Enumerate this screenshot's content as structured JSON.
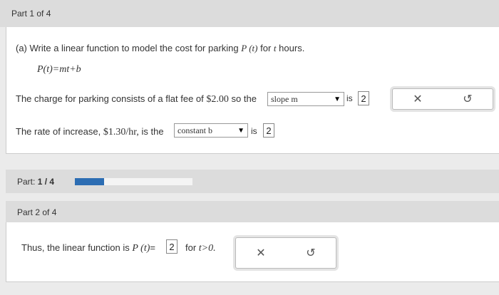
{
  "part1": {
    "header": "Part 1 of 4",
    "question": "(a) Write a linear function to model the cost for parking",
    "question_fn": "P (t)",
    "question_tail": "for",
    "question_var": "t",
    "question_end": "hours.",
    "formula": "P(t)=mt+b",
    "line1_text": "The charge for parking consists of a flat fee of",
    "line1_amount": "$2.00",
    "line1_so": "so the",
    "line1_select": "slope m",
    "line1_is": "is",
    "line1_value": "2",
    "line2_text": "The rate of increase,",
    "line2_amount": "$1.30/hr,",
    "line2_is_the": "is the",
    "line2_select": "constant b",
    "line2_is": "is",
    "line2_value": "2"
  },
  "buttons": {
    "clear": "✕",
    "undo": "↺"
  },
  "progress": {
    "label": "Part:",
    "value_text": "1 / 4",
    "fraction": 0.25,
    "accent": "#2c6db3"
  },
  "part2": {
    "header": "Part 2 of 4",
    "text": "Thus, the linear function is",
    "fn": "P (t)",
    "eq": "=",
    "value": "2",
    "tail": "for",
    "cond": "t>0."
  }
}
